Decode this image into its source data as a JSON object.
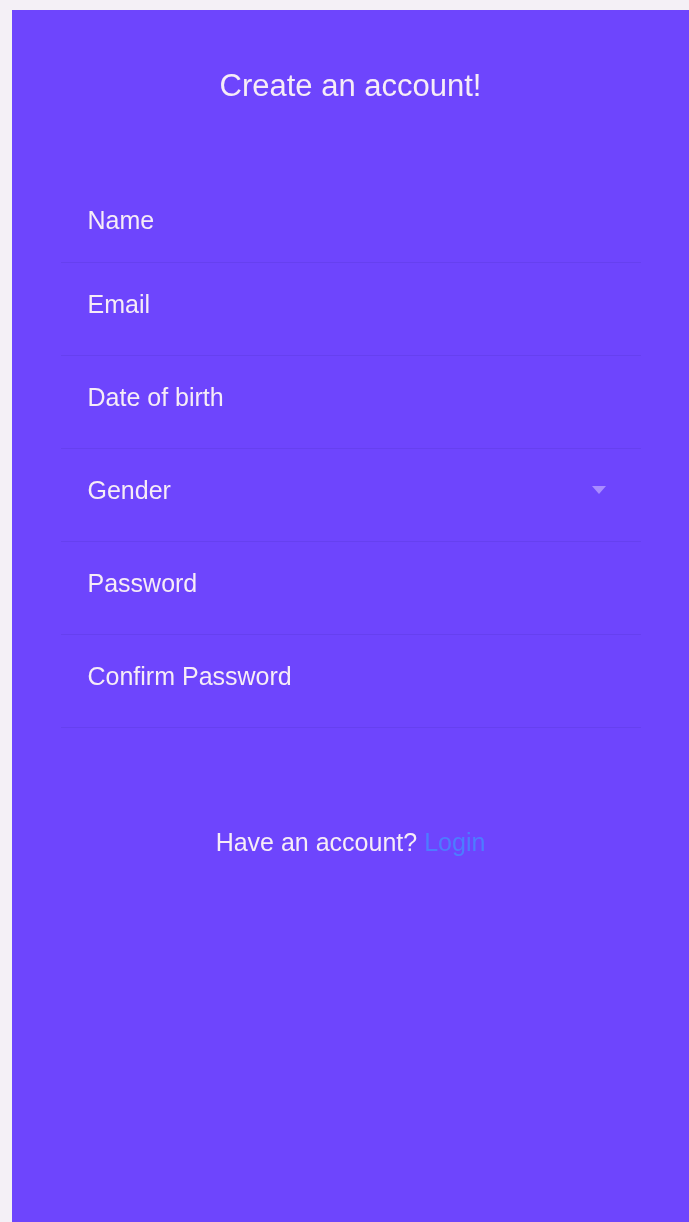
{
  "title": "Create an account!",
  "fields": [
    {
      "kind": "text",
      "placeholder": "Name"
    },
    {
      "kind": "text",
      "placeholder": "Email"
    },
    {
      "kind": "text",
      "placeholder": "Date of birth"
    },
    {
      "kind": "select",
      "placeholder": "Gender"
    },
    {
      "kind": "password",
      "placeholder": "Password"
    },
    {
      "kind": "password",
      "placeholder": "Confirm Password"
    }
  ],
  "footer": {
    "text": "Have an account?",
    "link": "Login"
  }
}
